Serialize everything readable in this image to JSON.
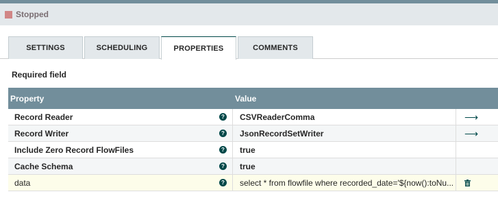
{
  "status": {
    "label": "Stopped",
    "color": "#d18686"
  },
  "tabs": [
    {
      "label": "SETTINGS",
      "active": false
    },
    {
      "label": "SCHEDULING",
      "active": false
    },
    {
      "label": "PROPERTIES",
      "active": true
    },
    {
      "label": "COMMENTS",
      "active": false
    }
  ],
  "required_label": "Required field",
  "table": {
    "headers": {
      "property": "Property",
      "value": "Value"
    },
    "rows": [
      {
        "property": "Record Reader",
        "value": "CSVReaderComma",
        "action": "arrow-right-icon"
      },
      {
        "property": "Record Writer",
        "value": "JsonRecordSetWriter",
        "action": "arrow-right-icon"
      },
      {
        "property": "Include Zero Record FlowFiles",
        "value": "true",
        "action": ""
      },
      {
        "property": "Cache Schema",
        "value": "true",
        "action": ""
      },
      {
        "property": "data",
        "value": "select * from flowfile where recorded_date='${now():toNu...",
        "action": "trash-icon"
      }
    ]
  },
  "colors": {
    "header": "#728e9b",
    "accent": "#004849",
    "highlight_row": "#fdfdea"
  }
}
